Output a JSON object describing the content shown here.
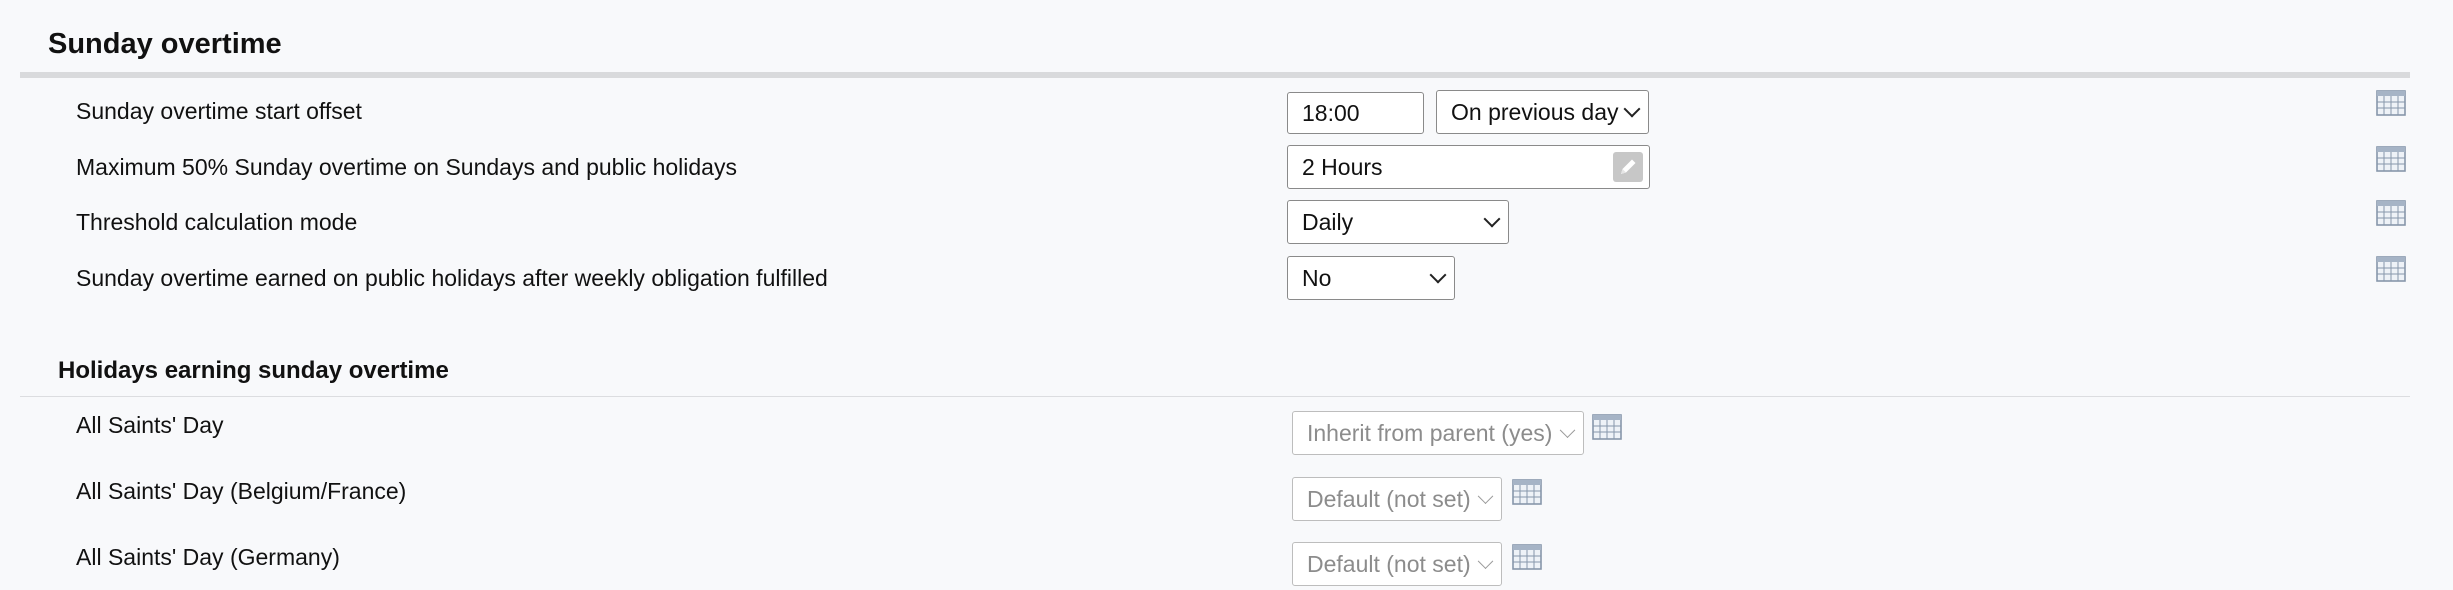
{
  "section": {
    "title": "Sunday overtime"
  },
  "settings": [
    {
      "label": "Sunday overtime start offset",
      "time_value": "18:00",
      "select_value": "On previous day"
    },
    {
      "label": "Maximum 50% Sunday overtime on Sundays and public holidays",
      "value": "2 Hours"
    },
    {
      "label": "Threshold calculation mode",
      "value": "Daily"
    },
    {
      "label": "Sunday overtime earned on public holidays after weekly obligation fulfilled",
      "value": "No"
    }
  ],
  "holidays": {
    "title": "Holidays earning sunday overtime",
    "items": [
      {
        "label": "All Saints' Day",
        "value": "Inherit from parent (yes)"
      },
      {
        "label": "All Saints' Day (Belgium/France)",
        "value": "Default (not set)"
      },
      {
        "label": "All Saints' Day (Germany)",
        "value": "Default (not set)"
      }
    ]
  },
  "icons": {
    "calendar": "calendar-icon",
    "edit": "pencil-icon",
    "dropdown": "chevron-down-icon"
  },
  "colors": {
    "background": "#f8f9fb",
    "divider": "#d9dadc",
    "calendar_icon": "#8a9bb0",
    "disabled_text": "#8c8c8c"
  }
}
